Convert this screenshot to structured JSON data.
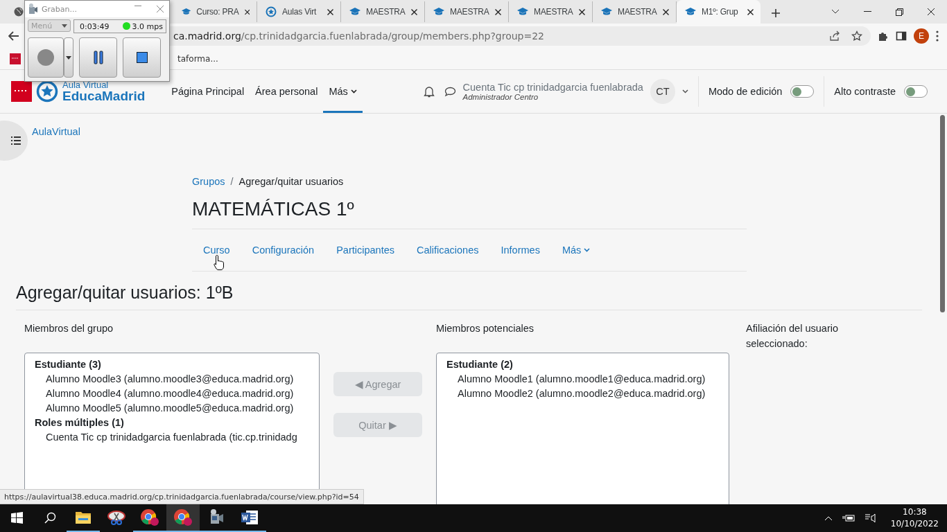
{
  "recorder": {
    "title": "Graban...",
    "menu": "Menú",
    "elapsed": "0:03:49",
    "rate": "3.0 mps"
  },
  "browser": {
    "tabs": [
      {
        "kind": "cap",
        "title": "Curso: PRA",
        "selected": false
      },
      {
        "kind": "star",
        "title": "Aulas Virt",
        "selected": false
      },
      {
        "kind": "cap",
        "title": "MAESTRA",
        "selected": false
      },
      {
        "kind": "cap",
        "title": "MAESTRA",
        "selected": false
      },
      {
        "kind": "cap",
        "title": "MAESTRA",
        "selected": false
      },
      {
        "kind": "cap",
        "title": "MAESTRA",
        "selected": false
      },
      {
        "kind": "cap",
        "title": "M1º: Grup",
        "selected": true
      }
    ],
    "address": {
      "host": "ca.madrid.org",
      "path": "/cp.trinidadgarcia.fuenlabrada/group/members.php?group=22"
    },
    "profile": "E",
    "bookmark": "taforma..."
  },
  "site": {
    "logo_top": "Aula Virtual",
    "logo_bottom": "EducaMadrid",
    "nav": [
      {
        "label": "Página Principal",
        "selected": false
      },
      {
        "label": "Área personal",
        "selected": false
      },
      {
        "label": "Más",
        "selected": true
      }
    ],
    "user": {
      "name": "Cuenta Tic cp trinidadgarcia fuenlabrada",
      "role": "Administrador Centro",
      "initials": "CT"
    },
    "toggles": [
      {
        "label": "Modo de edición",
        "on": false
      },
      {
        "label": "Alto contraste",
        "on": false
      }
    ]
  },
  "home_link": "AulaVirtual",
  "breadcrumb_separator": "/",
  "breadcrumb": [
    {
      "label": "Grupos",
      "link": true
    },
    {
      "label": "Agregar/quitar usuarios",
      "link": false
    }
  ],
  "course_title": "MATEMÁTICAS 1º",
  "course_nav": [
    {
      "label": "Curso",
      "dropdown": false
    },
    {
      "label": "Configuración",
      "dropdown": false
    },
    {
      "label": "Participantes",
      "dropdown": false
    },
    {
      "label": "Calificaciones",
      "dropdown": false
    },
    {
      "label": "Informes",
      "dropdown": false
    },
    {
      "label": "Más",
      "dropdown": true
    }
  ],
  "heading": "Agregar/quitar usuarios: 1ºB",
  "members": {
    "label": "Miembros del grupo",
    "groups": [
      {
        "name": "Estudiante (3)",
        "options": [
          "Alumno Moodle3 (alumno.moodle3@educa.madrid.org)",
          "Alumno Moodle4 (alumno.moodle4@educa.madrid.org)",
          "Alumno Moodle5 (alumno.moodle5@educa.madrid.org)"
        ]
      },
      {
        "name": "Roles múltiples (1)",
        "options": [
          "Cuenta Tic cp trinidadgarcia fuenlabrada (tic.cp.trinidadg"
        ]
      }
    ]
  },
  "actions": [
    {
      "label": "◀ Agregar",
      "disabled": true
    },
    {
      "label": "Quitar ▶",
      "disabled": true
    }
  ],
  "potential": {
    "label": "Miembros potenciales",
    "groups": [
      {
        "name": "Estudiante (2)",
        "options": [
          "Alumno Moodle1 (alumno.moodle1@educa.madrid.org)",
          "Alumno Moodle2 (alumno.moodle2@educa.madrid.org)"
        ]
      }
    ]
  },
  "affiliation_label": "Afiliación del usuario seleccionado:",
  "status_url": "https://aulavirtual38.educa.madrid.org/cp.trinidadgarcia.fuenlabrada/course/view.php?id=54",
  "taskbar": {
    "apps": [
      {
        "kind": "folder",
        "running": true,
        "selected": false
      },
      {
        "kind": "snip",
        "running": false,
        "selected": false
      },
      {
        "kind": "chrome",
        "running": true,
        "selected": false
      },
      {
        "kind": "chrome",
        "running": true,
        "selected": true
      },
      {
        "kind": "camera",
        "running": true,
        "selected": false
      },
      {
        "kind": "word",
        "running": true,
        "selected": false
      }
    ],
    "time": "10:38",
    "date": "10/10/2022"
  }
}
